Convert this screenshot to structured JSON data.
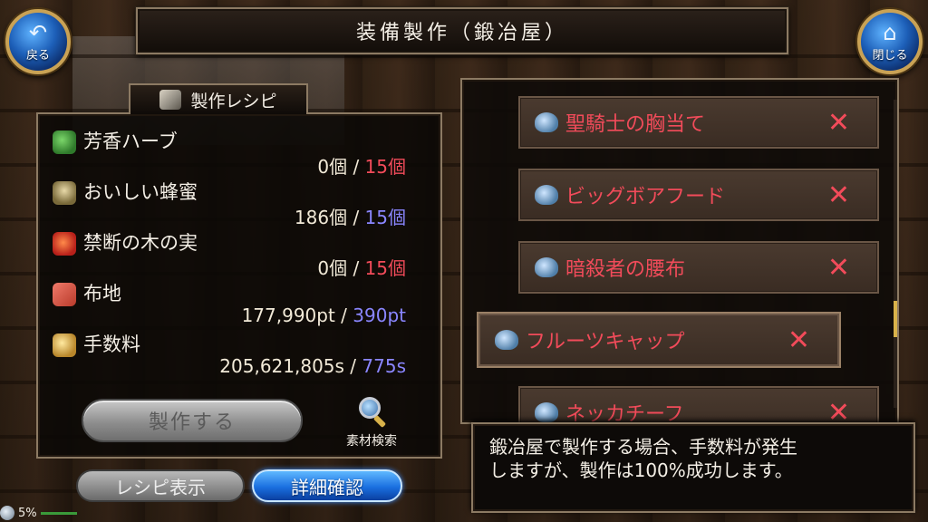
{
  "header": {
    "title": "装備製作（鍛冶屋）",
    "back_label": "戻る",
    "close_label": "閉じる",
    "back_icon": "back-arrow-icon",
    "close_icon": "home-icon"
  },
  "recipe": {
    "tab_label": "製作レシピ",
    "materials": [
      {
        "name": "芳香ハーブ",
        "have": "0個",
        "sep": " / ",
        "need": "15個",
        "need_color": "red",
        "icon": "herb-icon"
      },
      {
        "name": "おいしい蜂蜜",
        "have": "186個",
        "sep": " / ",
        "need": "15個",
        "need_color": "blue",
        "icon": "honey-icon"
      },
      {
        "name": "禁断の木の実",
        "have": "0個",
        "sep": " / ",
        "need": "15個",
        "need_color": "red",
        "icon": "fruit-icon"
      },
      {
        "name": "布地",
        "have": "177,990pt",
        "sep": " / ",
        "need": "390pt",
        "need_color": "blue",
        "icon": "cloth-icon"
      },
      {
        "name": "手数料",
        "have": "205,621,805s",
        "sep": " / ",
        "need": "775s",
        "need_color": "blue",
        "icon": "coin-icon"
      }
    ],
    "make_label": "製作する",
    "search_label": "素材検索"
  },
  "bottom": {
    "recipe_show_label": "レシピ表示",
    "detail_label": "詳細確認"
  },
  "list": {
    "items": [
      {
        "name": "聖騎士の胸当て",
        "mark": "✕"
      },
      {
        "name": "ビッグボアフード",
        "mark": "✕"
      },
      {
        "name": "暗殺者の腰布",
        "mark": "✕"
      },
      {
        "name": "フルーツキャップ",
        "mark": "✕"
      },
      {
        "name": "ネッカチーフ",
        "mark": "✕"
      }
    ]
  },
  "message": {
    "line1": "鍛冶屋で製作する場合、手数料が発生",
    "line2": "しますが、製作は100%成功します。"
  },
  "status": {
    "battery": "5%"
  }
}
